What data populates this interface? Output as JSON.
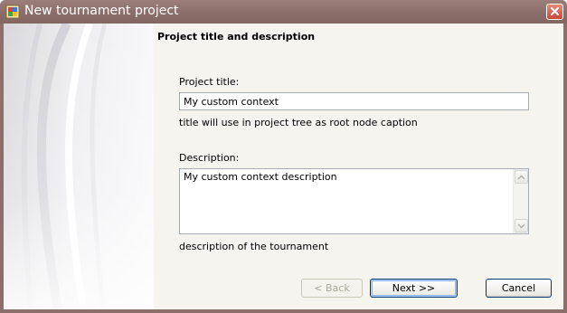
{
  "window": {
    "title": "New tournament project"
  },
  "icons": {
    "app": "app-icon",
    "close": "close-icon",
    "scroll_up": "scroll-up-arrow-icon",
    "scroll_down": "scroll-down-arrow-icon"
  },
  "page": {
    "heading": "Project title and description"
  },
  "project_title": {
    "label": "Project title:",
    "value": "My custom context",
    "hint": "title will use in project tree as root node caption"
  },
  "description": {
    "label": "Description:",
    "value": "My custom context description",
    "hint": "description of the tournament"
  },
  "buttons": {
    "back": "< Back",
    "next": "Next >>",
    "cancel": "Cancel"
  },
  "colors": {
    "titlebar": "#8b6f6b",
    "dialog_bg": "#f5f4ef",
    "button_border": "#003c74"
  }
}
